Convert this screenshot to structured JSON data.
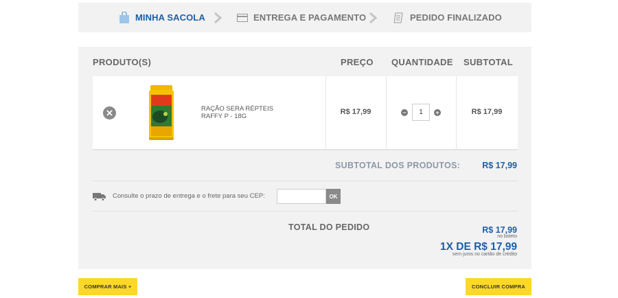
{
  "steps": {
    "step1": "MINHA SACOLA",
    "step2": "ENTREGA E PAGAMENTO",
    "step3": "PEDIDO FINALIZADO"
  },
  "table": {
    "headers": {
      "produtos": "PRODUTO(S)",
      "preco": "PREÇO",
      "quantidade": "QUANTIDADE",
      "subtotal": "SUBTOTAL"
    },
    "rows": [
      {
        "name": "RAÇÃO SERA RÉPTEIS RAFFY P - 18G",
        "price": "R$ 17,99",
        "quantity": "1",
        "subtotal": "R$ 17,99"
      }
    ]
  },
  "summary": {
    "subtotal_label": "SUBTOTAL DOS PRODUTOS:",
    "subtotal_value": "R$ 17,99",
    "cep_label": "Consulte o prazo de entrega e o frete para seu CEP:",
    "cep_value": "",
    "cep_ok": "OK",
    "total_label": "TOTAL DO PEDIDO",
    "total_boleto": "R$ 17,99",
    "total_boleto_note": "no boleto",
    "total_parcelado": "1X DE R$ 17,99",
    "total_parcelado_note": "sem juros no cartão de crédito"
  },
  "buttons": {
    "comprar_mais": "COMPRAR MAIS +",
    "concluir": "CONCLUIR COMPRA"
  },
  "colors": {
    "accent_blue": "#1e5fa6",
    "button_yellow": "#fdd826",
    "panel_bg": "#f2f2f2"
  },
  "icons": {
    "step1": "shopping-bag-icon",
    "step2": "credit-card-icon",
    "step3": "receipt-icon",
    "remove": "remove-icon",
    "decrease": "minus-icon",
    "increase": "plus-icon",
    "shipping": "truck-icon"
  }
}
